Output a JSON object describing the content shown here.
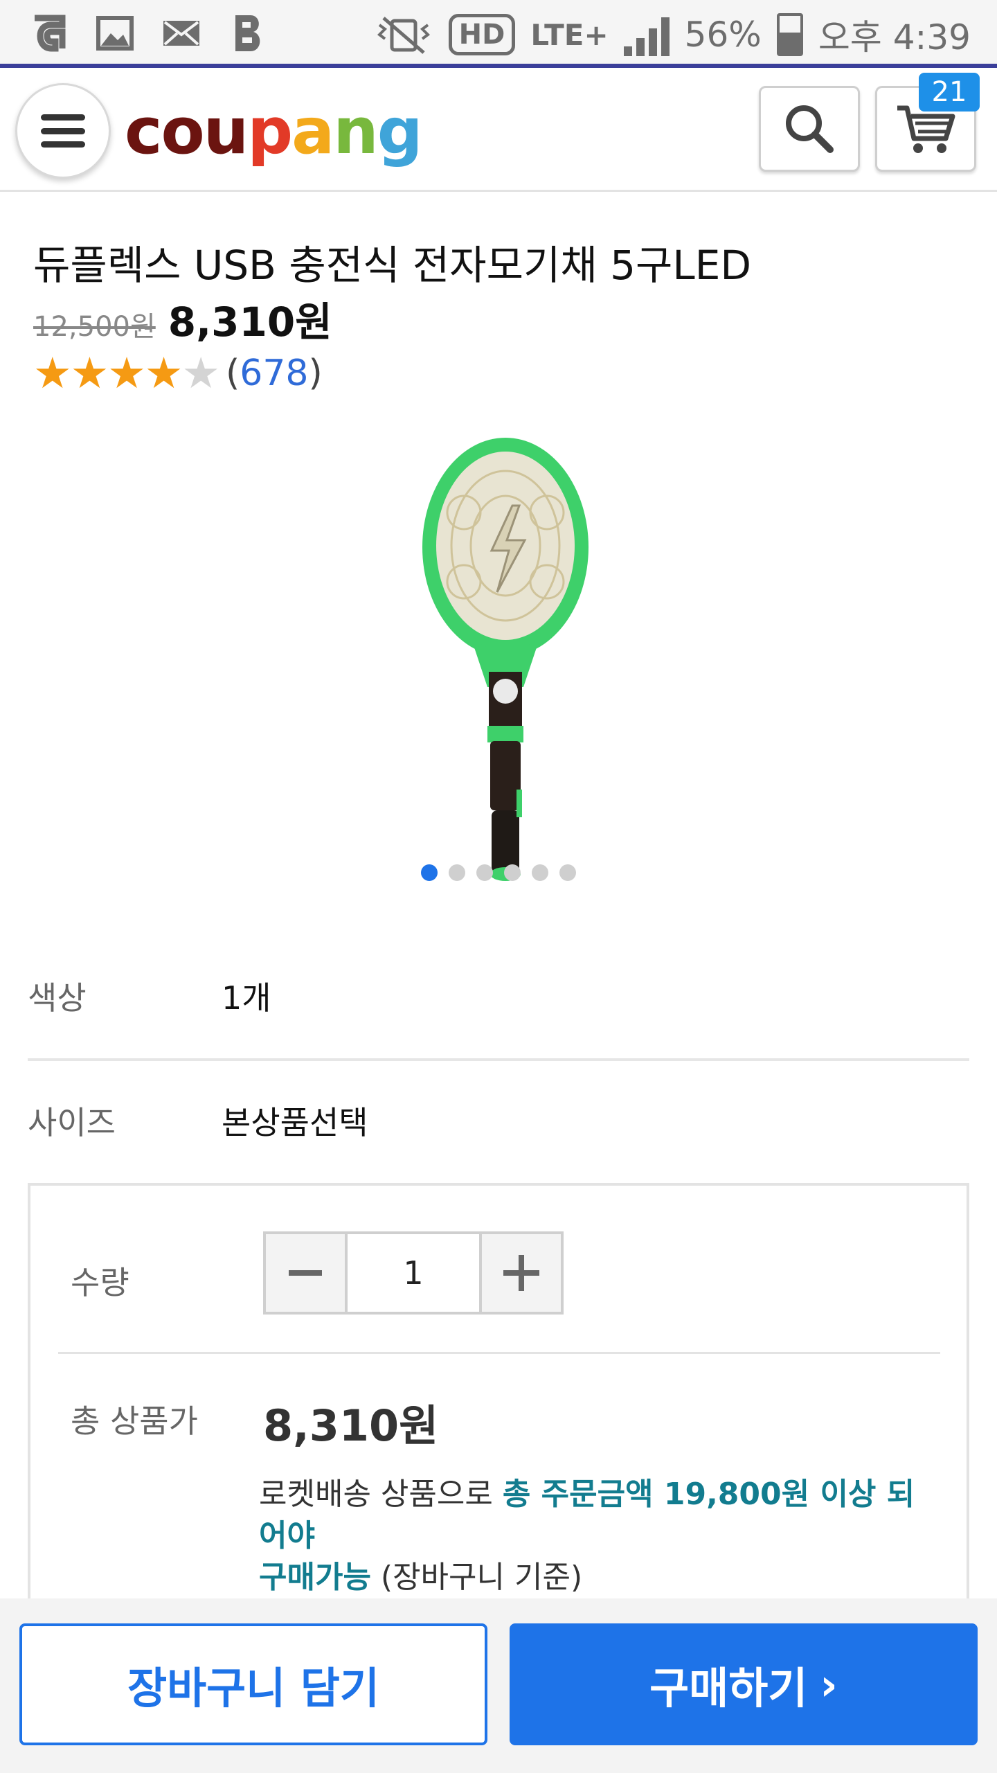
{
  "status_bar": {
    "battery_percent": "56%",
    "time": "오후 4:39",
    "hd_label": "HD",
    "network_label": "LTE+"
  },
  "header": {
    "logo": [
      "c",
      "o",
      "u",
      "p",
      "a",
      "n",
      "g"
    ],
    "cart_count": "21"
  },
  "product": {
    "title": "듀플렉스 USB 충전식 전자모기채 5구LED",
    "original_price": "12,500원",
    "sale_price": "8,310원",
    "rating_stars": 4,
    "review_count": "678",
    "image_index": 1,
    "image_total": 6
  },
  "options": {
    "color_label": "색상",
    "color_value": "1개",
    "size_label": "사이즈",
    "size_value": "본상품선택"
  },
  "quantity": {
    "label": "수량",
    "value": "1",
    "minus": "−",
    "plus": "+"
  },
  "total": {
    "label": "총 상품가",
    "price": "8,310원"
  },
  "notice": {
    "text_1": "로켓배송 상품으로 ",
    "highlight_1": "총 주문금액 19,800원 이상 되어야",
    "highlight_2": "구매가능",
    "text_2": " (장바구니 기준)"
  },
  "actions": {
    "add_to_cart": "장바구니 담기",
    "buy_now": "구매하기",
    "buy_arrow": "›"
  },
  "colors": {
    "accent": "#1e73e8",
    "notice_highlight": "#127c8f",
    "star": "#f59a13"
  }
}
